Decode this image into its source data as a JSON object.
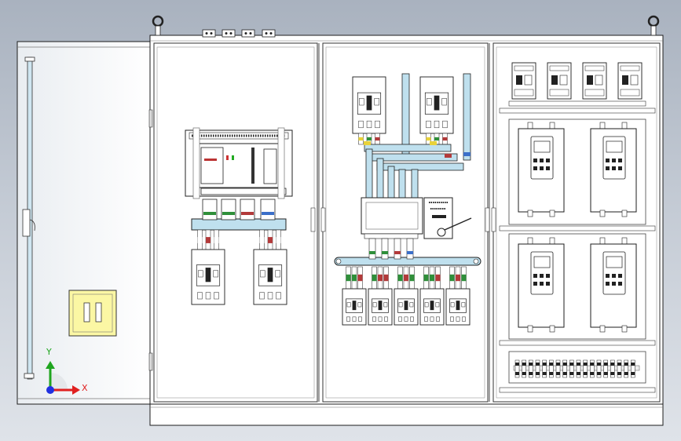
{
  "viewport": {
    "background_top": "#a9b2bf",
    "background_bottom": "#dfe3e9"
  },
  "colors": {
    "panel": "#ffffff",
    "outline": "#1c1c1c",
    "busbar": "#bfe0ee",
    "phase_yellow": "#e8d23a",
    "phase_green": "#2f8f3a",
    "phase_red": "#b23a3a",
    "phase_blue": "#3b6fc9",
    "handle": "#fbf7a4",
    "axis_x": "#e02020",
    "axis_y": "#1fa51f",
    "axis_origin": "#2030e0"
  },
  "components": {
    "lifting_eyes": [
      "lifting-eye-left",
      "lifting-eye-right"
    ],
    "roof_vents": 4,
    "left_section": {
      "main_breaker_label": "",
      "outgoing_breakers": 2
    },
    "middle_section": {
      "incoming_breakers": 2,
      "transfer_switch": "transfer-switch",
      "outgoing_breakers": 5
    },
    "right_section": {
      "top_relays": 4,
      "soft_starters": 4,
      "terminal_strip_blocks": 18
    }
  },
  "triad": {
    "x_label": "X",
    "y_label": "Y"
  }
}
